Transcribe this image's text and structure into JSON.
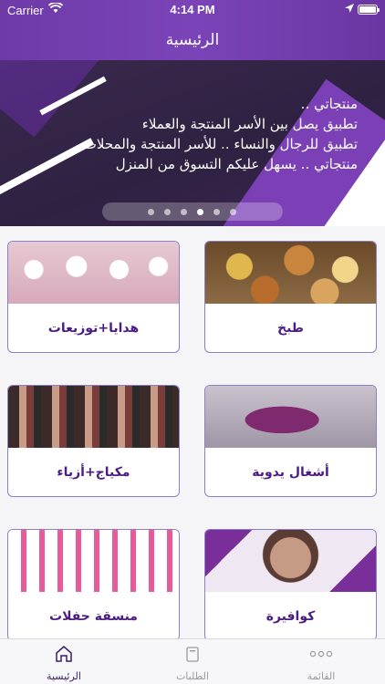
{
  "status_bar": {
    "carrier": "Carrier",
    "time": "4:14 PM"
  },
  "nav": {
    "title": "الرئيسية"
  },
  "banner": {
    "lines": [
      "منتجاتي ..",
      "تطبيق يصل بين الأسر المنتجة والعملاء",
      "تطبيق للرجال والنساء .. للأسر المنتجة والمحلات",
      "منتجاتي .. يسهل عليكم التسوق من المنزل"
    ],
    "page_count": 6,
    "active_page": 4
  },
  "categories": [
    {
      "label": "طبخ",
      "icon": "food-photo"
    },
    {
      "label": "هدايا+توزيعات",
      "icon": "gifts-photo"
    },
    {
      "label": "أشغال يدوية",
      "icon": "handicraft-photo"
    },
    {
      "label": "مكياج+أزياء",
      "icon": "makeup-photo"
    },
    {
      "label": "كوافيرة",
      "icon": "coiffure-photo"
    },
    {
      "label": "منسقة حفلات",
      "icon": "party-photo"
    }
  ],
  "tabbar": {
    "home": {
      "label": "الرئيسية",
      "icon": "home-icon"
    },
    "orders": {
      "label": "الطلبات",
      "icon": "orders-icon"
    },
    "menu": {
      "label": "القائمة",
      "icon": "more-icon"
    }
  },
  "colors": {
    "accent": "#6e3aa8",
    "label_text": "#4b1d82",
    "card_border": "#8a80c4"
  }
}
